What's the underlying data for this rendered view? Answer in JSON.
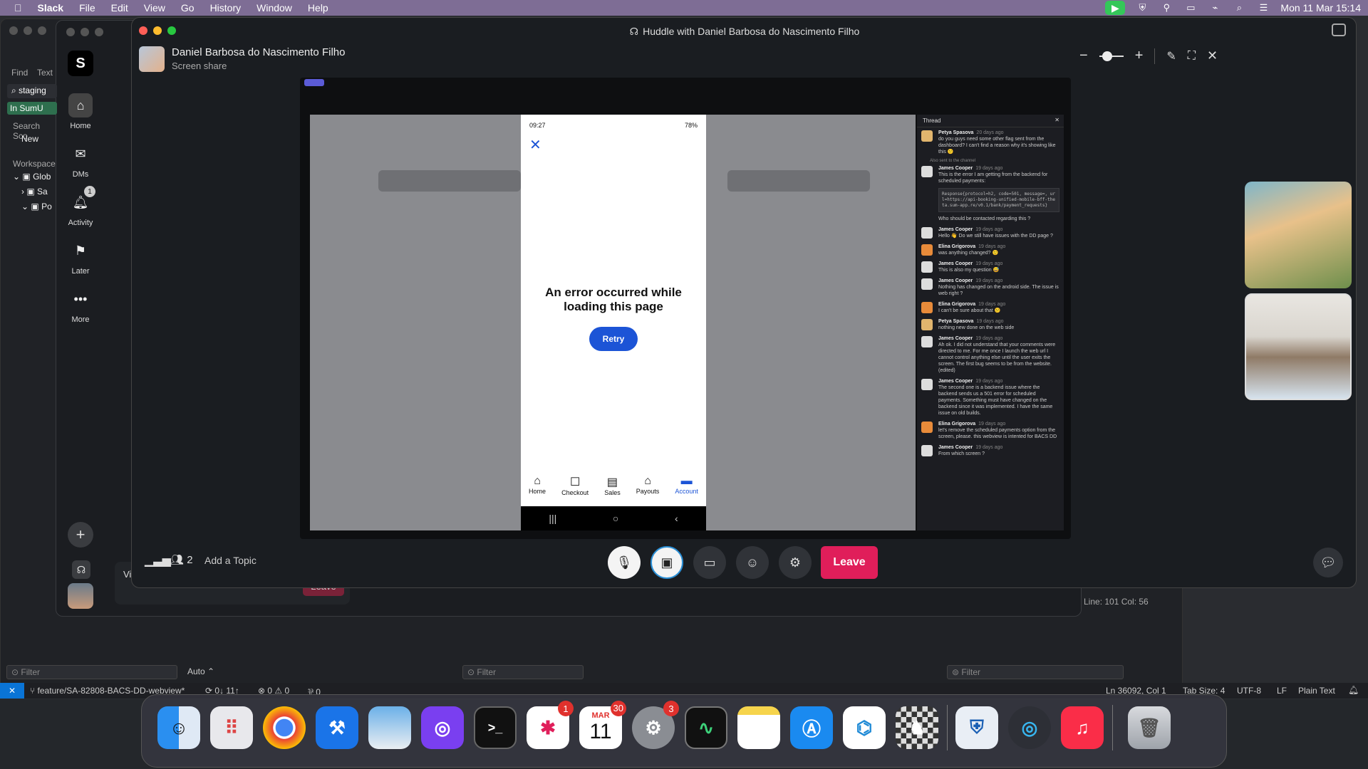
{
  "menubar": {
    "apple": "",
    "app": "Slack",
    "items": [
      "File",
      "Edit",
      "View",
      "Go",
      "History",
      "Window",
      "Help"
    ],
    "clock": "Mon 11 Mar 15:14"
  },
  "slack": {
    "rail": [
      {
        "label": "Home"
      },
      {
        "label": "DMs"
      },
      {
        "label": "Activity",
        "badge": "1"
      },
      {
        "label": "Later"
      },
      {
        "label": "More"
      }
    ],
    "sidebar": {
      "find": "Find",
      "text": "Text",
      "search_value": "staging",
      "in_sumup": "In SumU",
      "search_scope": "Search Sco",
      "new": "New",
      "workspace": "Workspace",
      "glob": "Glob",
      "sa": "Sa",
      "po": "Po"
    },
    "leave_small": "Leave",
    "vi": "Vi"
  },
  "huddle": {
    "title": "Huddle with Daniel Barbosa do Nascimento Filho",
    "presenter_name": "Daniel Barbosa do Nascimento Filho",
    "presenter_sub": "Screen share",
    "participants": "2",
    "add_topic": "Add a Topic",
    "leave": "Leave"
  },
  "phone": {
    "time": "09:27",
    "battery": "78%",
    "error_title": "An error occurred while loading this page",
    "retry": "Retry",
    "nav": [
      "Home",
      "Checkout",
      "Sales",
      "Payouts",
      "Account"
    ]
  },
  "thread": {
    "title": "Thread",
    "also_sent": "Also sent to the channel",
    "code": "Response{protocol=h2, code=501, message=, url=https://api-booking-unified-mobile-bff-theta.sum-app.re/v0.1/bank/payment_requests}",
    "messages": [
      {
        "who": "Petya Spasova",
        "when": "20 days ago",
        "text": "do you guys need some other flag sent from the dashboard? I can't find a reason why it's showing like this 😕"
      },
      {
        "who": "James Cooper",
        "when": "19 days ago",
        "text": "This is the error I am getting from the backend for scheduled payments:"
      },
      {
        "who": "",
        "when": "",
        "text": "Who should be contacted regarding this ?"
      },
      {
        "who": "James Cooper",
        "when": "19 days ago",
        "text": "Hello 👋 Do we still have issues with the DD page ?"
      },
      {
        "who": "Elina Grigorova",
        "when": "19 days ago",
        "text": "was anything changed? 🙂"
      },
      {
        "who": "James Cooper",
        "when": "19 days ago",
        "text": "This is also my question 😅"
      },
      {
        "who": "James Cooper",
        "when": "19 days ago",
        "text": "Nothing has changed on the android side. The issue is web right ?"
      },
      {
        "who": "Elina Grigorova",
        "when": "19 days ago",
        "text": "I can't be sure about that 😕"
      },
      {
        "who": "Petya Spasova",
        "when": "19 days ago",
        "text": "nothing new done on the web side"
      },
      {
        "who": "James Cooper",
        "when": "19 days ago",
        "text": "Ah ok. I did not understand that your comments were directed to me. For me once I launch the web url I cannot control anything else until the user exits the screen. The first bug seems to be from the website. (edited)"
      },
      {
        "who": "James Cooper",
        "when": "19 days ago",
        "text": "The second one is a backend issue where the backend sends us a 501 error for scheduled payments. Something must have changed on the backend since it was implemented. I have the same issue on old builds."
      },
      {
        "who": "Elina Grigorova",
        "when": "19 days ago",
        "text": "let's remove the scheduled payments option from the screen, please. this webview is intented for BACS DD"
      },
      {
        "who": "James Cooper",
        "when": "19 days ago",
        "text": "From which screen ?"
      }
    ]
  },
  "editor": {
    "line_col": "Line: 101  Col: 56",
    "filter": "Filter",
    "auto": "Auto",
    "branch": "feature/SA-82808-BACS-DD-webview*",
    "sync": "0↓ 11↑",
    "problems": "⊗ 0 ⚠ 0",
    "ports": "⅌ 0",
    "position": "Ln 36092, Col 1",
    "tab_size": "Tab Size: 4",
    "encoding": "UTF-8",
    "eol": "LF",
    "lang": "Plain Text"
  },
  "dock": {
    "calendar_month": "MAR",
    "calendar_day": "11",
    "badges": {
      "slack": "1",
      "calendar": "30",
      "settings": "3"
    }
  }
}
